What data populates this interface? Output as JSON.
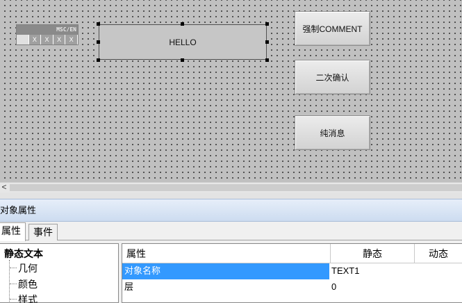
{
  "canvas": {
    "mini_widget": {
      "header": "MSC/EN",
      "cells": [
        "",
        "X",
        "X",
        "X",
        "X"
      ]
    },
    "hello_text": "HELLO",
    "buttons": [
      {
        "label": "强制COMMENT"
      },
      {
        "label": "二次确认"
      },
      {
        "label": "纯消息"
      }
    ]
  },
  "scrollbar": {
    "left_arrow": "<"
  },
  "panel": {
    "title": "对象属性",
    "tabs": [
      {
        "label": "属性",
        "active": true
      },
      {
        "label": "事件",
        "active": false
      }
    ],
    "tree": {
      "root": "静态文本",
      "children": [
        "几何",
        "颜色",
        "样式"
      ]
    },
    "grid": {
      "columns": [
        "属性",
        "静态",
        "动态"
      ],
      "rows": [
        {
          "name": "对象名称",
          "static": "TEXT1",
          "dynamic": "",
          "selected": true
        },
        {
          "name": "层",
          "static": "0",
          "dynamic": "",
          "selected": false
        }
      ]
    }
  }
}
